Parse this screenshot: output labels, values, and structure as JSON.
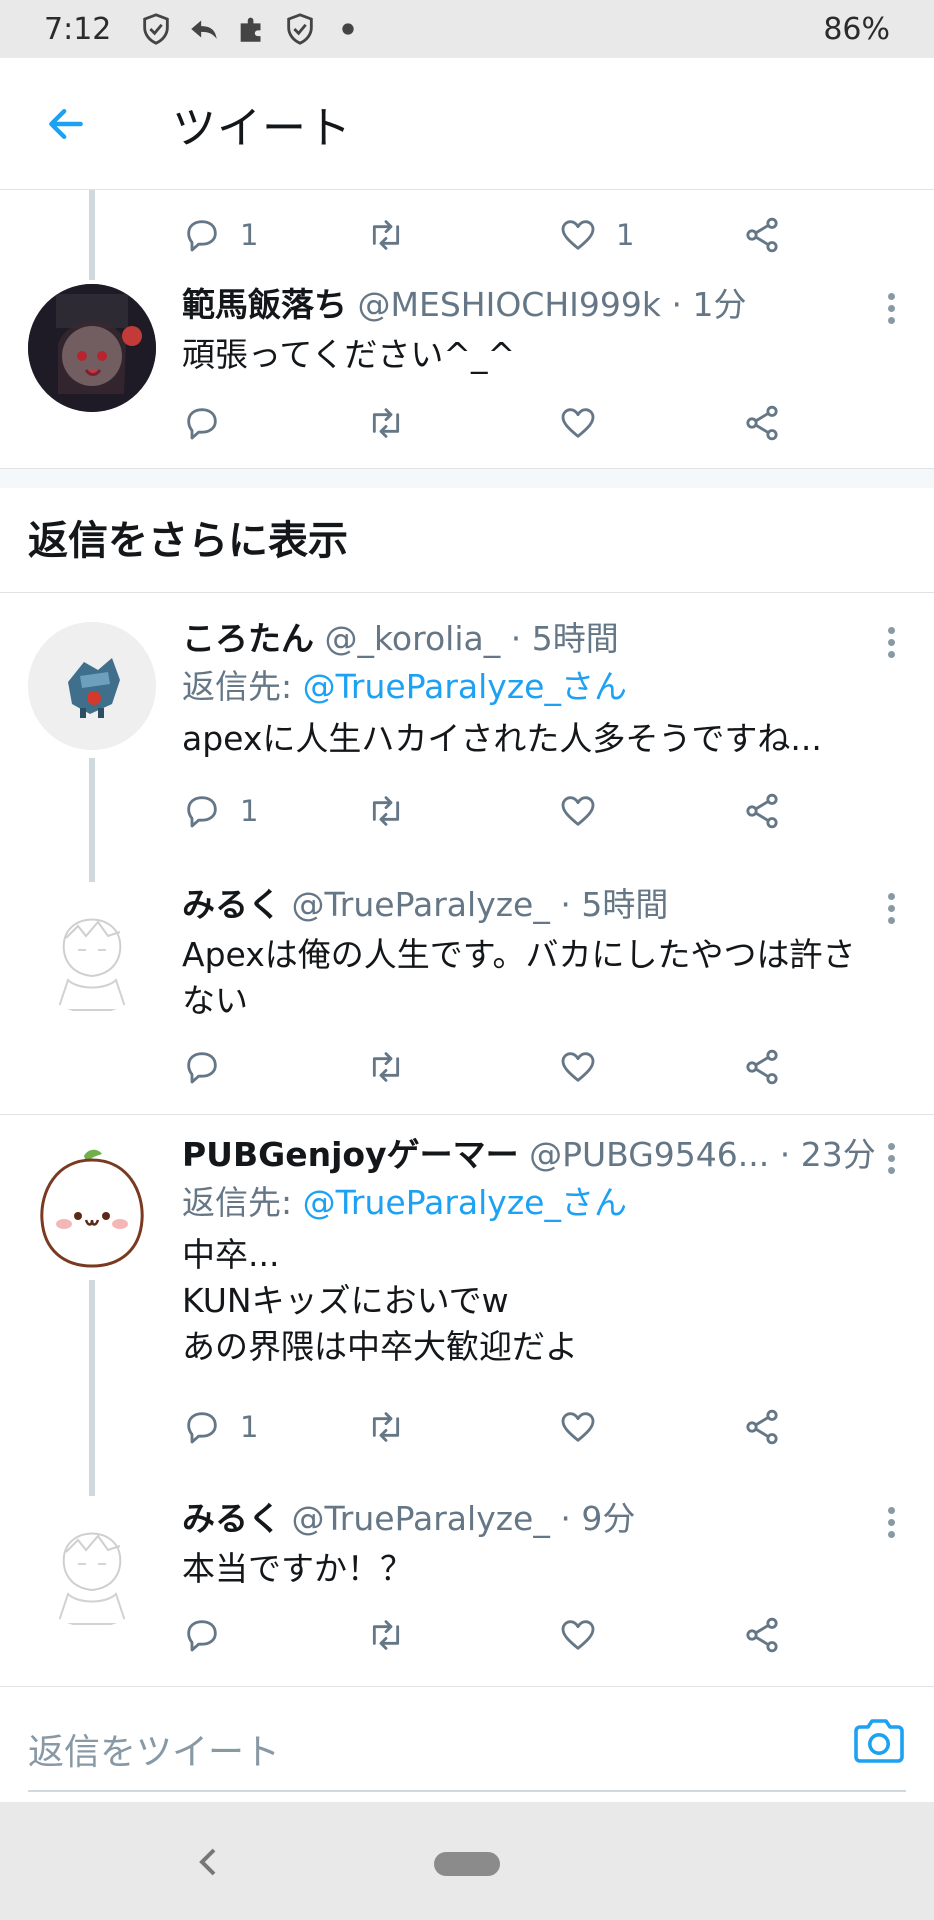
{
  "status_bar": {
    "time": "7:12",
    "battery": "86%"
  },
  "header": {
    "title": "ツイート"
  },
  "top_partial": {
    "reply_count": "1",
    "like_count": "1"
  },
  "tweets": [
    {
      "name": "範馬飯落ち",
      "handle": "@MESHIOCHI999k",
      "time": "· 1分",
      "text": "頑張ってください^_^"
    }
  ],
  "more_replies_label": "返信をさらに表示",
  "threads": [
    {
      "name": "ころたん",
      "handle": "@_korolia_",
      "time": "· 5時間",
      "reply_prefix": "返信先: ",
      "reply_handle": "@TrueParalyze_さん",
      "text": "apexに人生ハカイされた人多そうですね...",
      "reply_count": "1"
    },
    {
      "name": "みるく",
      "handle": "@TrueParalyze_",
      "time": "· 5時間",
      "text_line1": "Apexは俺の人生です。バカにしたやつは許さ",
      "text_line2": "ない"
    },
    {
      "name": "PUBGenjoyゲーマー",
      "handle": "@PUBG9546...",
      "time": "· 23分",
      "reply_prefix": "返信先: ",
      "reply_handle": "@TrueParalyze_さん",
      "text_line1": "中卒...",
      "text_line2": "KUNキッズにおいでw",
      "text_line3": "あの界隈は中卒大歓迎だよ",
      "reply_count": "1"
    },
    {
      "name": "みるく",
      "handle": "@TrueParalyze_",
      "time": "· 9分",
      "text": "本当ですか！？"
    }
  ],
  "compose": {
    "placeholder": "返信をツイート"
  },
  "colors": {
    "accent": "#1da1f2",
    "secondary_text": "#657786",
    "primary_text": "#14171a"
  }
}
